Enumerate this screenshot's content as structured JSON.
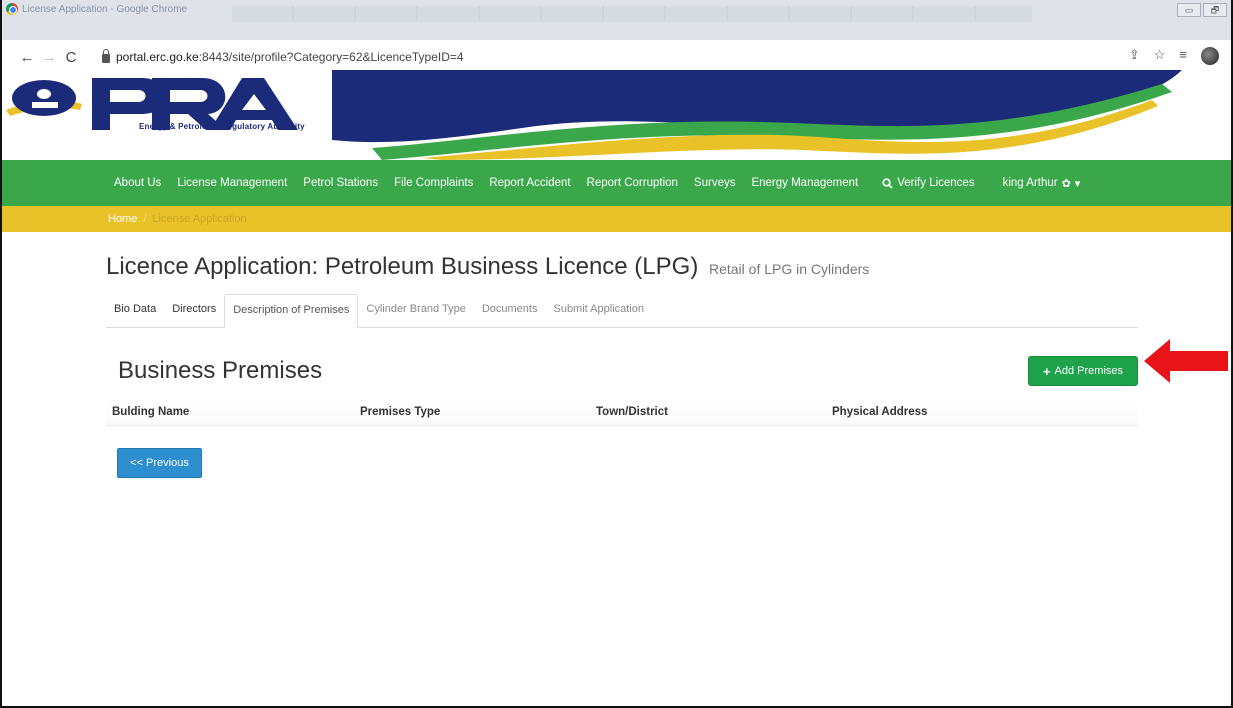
{
  "browser": {
    "window_title": "License Application - Google Chrome",
    "url_host": "portal.erc.go.ke",
    "url_rest": ":8443/site/profile?Category=62&LicenceTypeID=4",
    "window_controls": [
      "▭",
      "🗗"
    ]
  },
  "header": {
    "logo_text": "EPRA",
    "logo_subtitle": "Energy & Petroleum Regulatory Authority",
    "brand_colors": {
      "blue": "#1c2a7a",
      "green": "#3aa84a",
      "yellow": "#e9c22a"
    }
  },
  "nav": {
    "items": [
      "About Us",
      "License Management",
      "Petrol Stations",
      "File Complaints",
      "Report Accident",
      "Report Corruption",
      "Surveys",
      "Energy Management"
    ],
    "verify_label": "Verify Licences",
    "user_label": "king Arthur"
  },
  "breadcrumb": {
    "home": "Home",
    "current": "License Application"
  },
  "page": {
    "title": "Licence Application: Petroleum Business Licence (LPG)",
    "subtitle": "Retail of LPG in Cylinders"
  },
  "tabs": [
    {
      "label": "Bio Data"
    },
    {
      "label": "Directors"
    },
    {
      "label": "Description of Premises"
    },
    {
      "label": "Cylinder Brand Type"
    },
    {
      "label": "Documents"
    },
    {
      "label": "Submit Application"
    }
  ],
  "section": {
    "title": "Business Premises",
    "add_button": "Add Premises"
  },
  "table": {
    "columns": [
      "Bulding Name",
      "Premises Type",
      "Town/District",
      "Physical Address"
    ],
    "rows": []
  },
  "footer": {
    "prev_button": "<< Previous"
  },
  "annotation": {
    "arrow_color": "#e8141a"
  }
}
